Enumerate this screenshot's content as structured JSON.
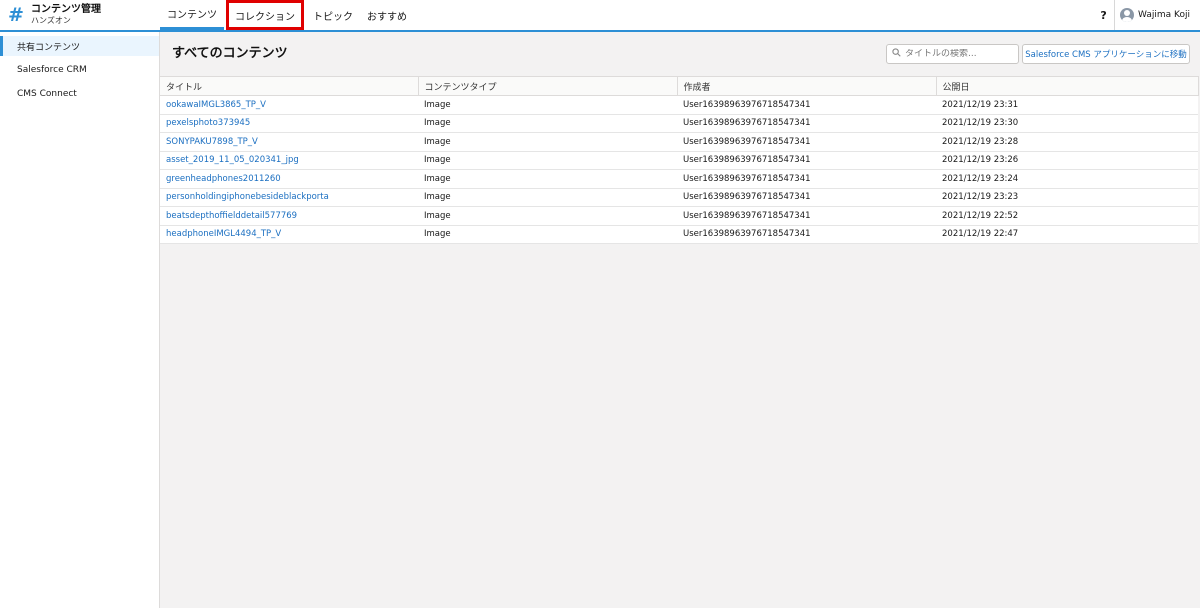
{
  "app": {
    "title": "コンテンツ管理",
    "subtitle": "ハンズオン"
  },
  "nav": {
    "tabs": [
      {
        "label": "コンテンツ",
        "active": true
      },
      {
        "label": "コレクション",
        "highlighted": true
      },
      {
        "label": "トピック"
      },
      {
        "label": "おすすめ"
      }
    ]
  },
  "header": {
    "help_label": "?",
    "user_name": "Wajima Koji"
  },
  "sidebar": {
    "items": [
      {
        "label": "共有コンテンツ",
        "active": true
      },
      {
        "label": "Salesforce CRM"
      },
      {
        "label": "CMS Connect"
      }
    ]
  },
  "main": {
    "title": "すべてのコンテンツ",
    "search": {
      "placeholder": "タイトルの検索..."
    },
    "cms_button_label": "Salesforce CMS アプリケーションに移動"
  },
  "table": {
    "headers": [
      "タイトル",
      "コンテンツタイプ",
      "作成者",
      "公開日"
    ],
    "rows": [
      {
        "title": "ookawaIMGL3865_TP_V",
        "type": "Image",
        "author": "User16398963976718547341",
        "date": "2021/12/19 23:31"
      },
      {
        "title": "pexelsphoto373945",
        "type": "Image",
        "author": "User16398963976718547341",
        "date": "2021/12/19 23:30"
      },
      {
        "title": "SONYPAKU7898_TP_V",
        "type": "Image",
        "author": "User16398963976718547341",
        "date": "2021/12/19 23:28"
      },
      {
        "title": "asset_2019_11_05_020341_jpg",
        "type": "Image",
        "author": "User16398963976718547341",
        "date": "2021/12/19 23:26"
      },
      {
        "title": "greenheadphones2011260",
        "type": "Image",
        "author": "User16398963976718547341",
        "date": "2021/12/19 23:24"
      },
      {
        "title": "personholdingiphonebesideblackporta",
        "type": "Image",
        "author": "User16398963976718547341",
        "date": "2021/12/19 23:23"
      },
      {
        "title": "beatsdepthoffielddetail577769",
        "type": "Image",
        "author": "User16398963976718547341",
        "date": "2021/12/19 22:52"
      },
      {
        "title": "headphoneIMGL4494_TP_V",
        "type": "Image",
        "author": "User16398963976718547341",
        "date": "2021/12/19 22:47"
      }
    ]
  },
  "colors": {
    "accent": "#2d8fd5",
    "link": "#1b6fc1",
    "highlight_box": "#e00000"
  }
}
